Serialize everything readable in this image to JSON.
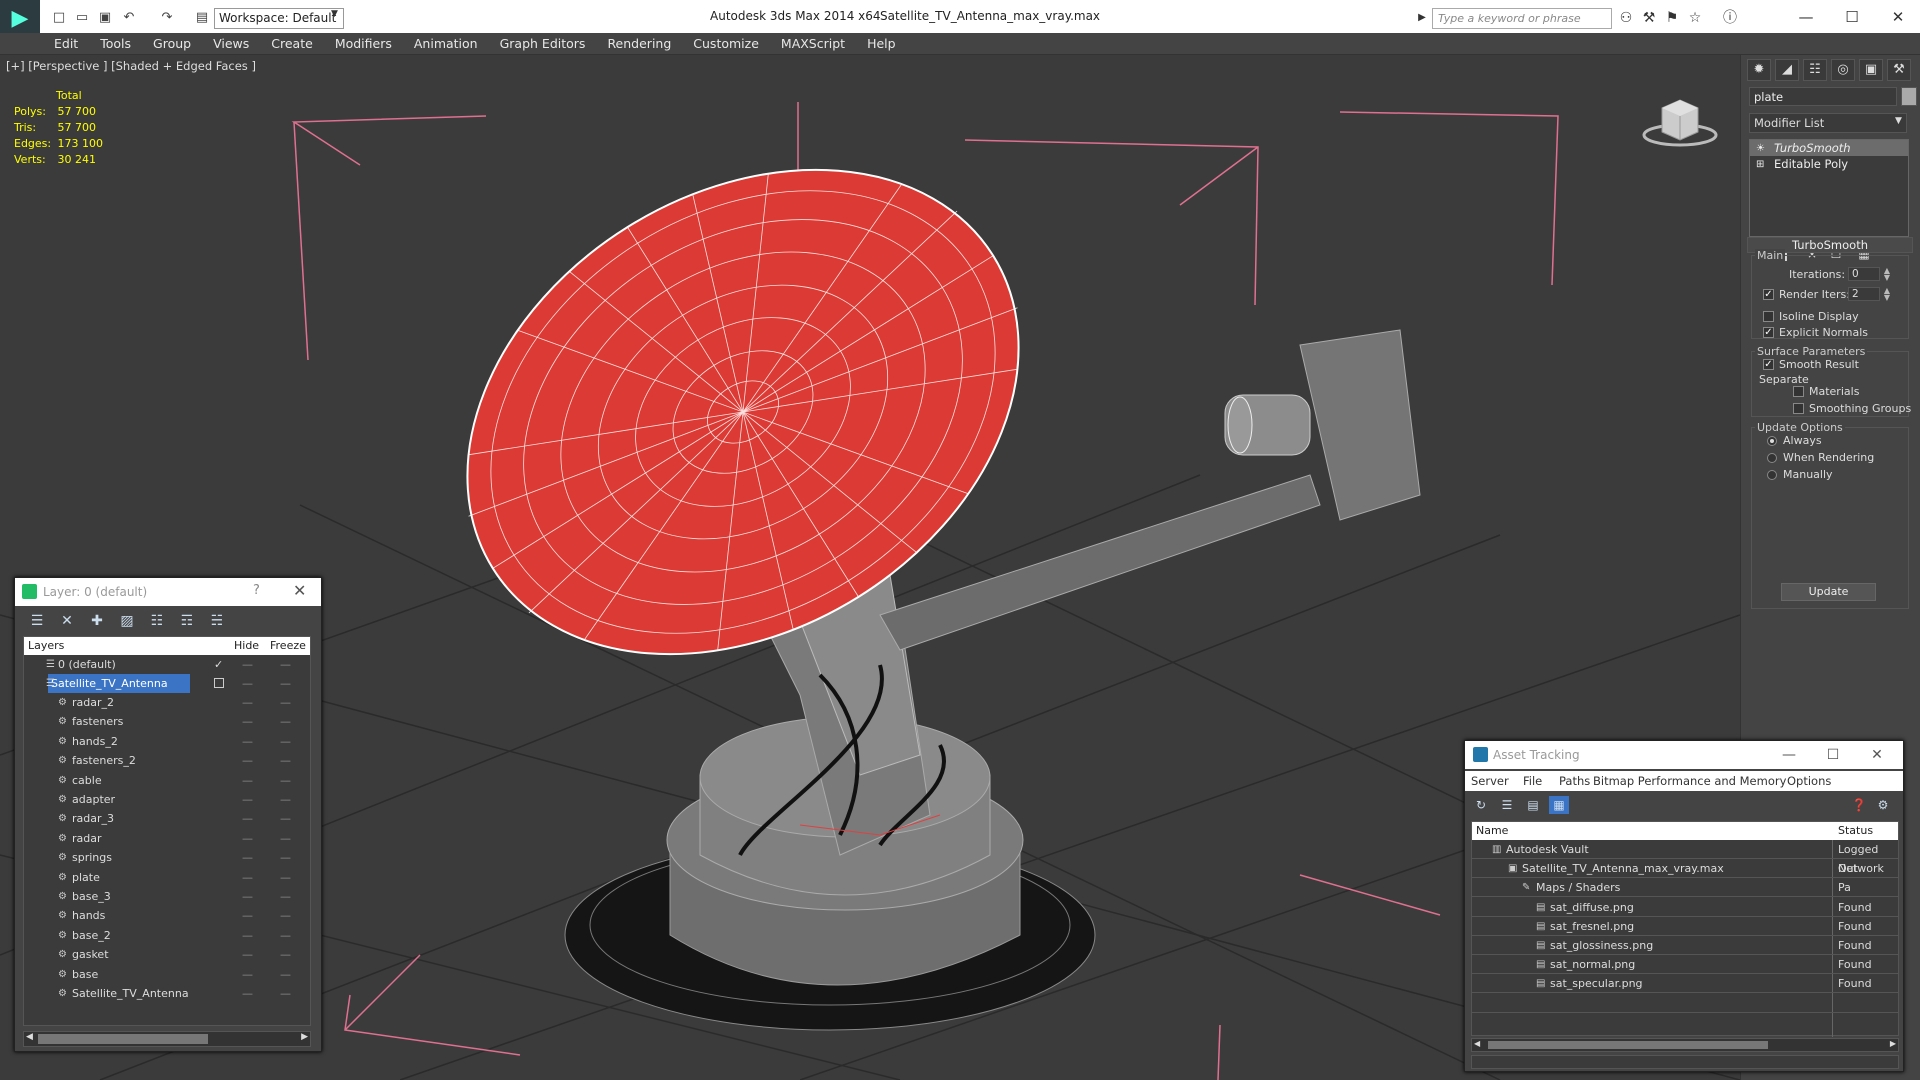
{
  "titlebar": {
    "app_title": "Autodesk 3ds Max  2014 x64",
    "file_name": "Satellite_TV_Antenna_max_vray.max",
    "workspace": "Workspace: Default",
    "search_placeholder": "Type a keyword or phrase",
    "minimize": "—",
    "maximize": "☐",
    "close": "✕"
  },
  "menu": [
    "Edit",
    "Tools",
    "Group",
    "Views",
    "Create",
    "Modifiers",
    "Animation",
    "Graph Editors",
    "Rendering",
    "Customize",
    "MAXScript",
    "Help"
  ],
  "viewport": {
    "label": "[+] [Perspective ] [Shaded + Edged Faces ]",
    "stats": {
      "header": "Total",
      "rows": [
        {
          "label": "Polys:",
          "value": "57 700"
        },
        {
          "label": "Tris:",
          "value": "57 700"
        },
        {
          "label": "Edges:",
          "value": "173 100"
        },
        {
          "label": "Verts:",
          "value": "30 241"
        }
      ]
    },
    "colors": {
      "dish": "#dc3a34",
      "wire": "#ffffff",
      "bbox": "#e06a8c",
      "grid": "#2c2c2c",
      "model": "#7a7a7a"
    }
  },
  "command_panel": {
    "object_name": "plate",
    "modifier_list": "Modifier List",
    "stack": [
      "TurboSmooth",
      "Editable Poly"
    ],
    "rollout_title": "TurboSmooth",
    "main_group": "Main",
    "iterations_label": "Iterations:",
    "iterations_value": "0",
    "render_iters_label": "Render Iters:",
    "render_iters_value": "2",
    "isoline_display": "Isoline Display",
    "explicit_normals": "Explicit Normals",
    "surface_params": "Surface Parameters",
    "smooth_result": "Smooth Result",
    "separate": "Separate",
    "materials": "Materials",
    "smoothing_groups": "Smoothing Groups",
    "update_options": "Update Options",
    "always": "Always",
    "when_rendering": "When Rendering",
    "manually": "Manually",
    "update_button": "Update"
  },
  "layer_window": {
    "title": "Layer: 0 (default)",
    "help": "?",
    "close": "✕",
    "col_layers": "Layers",
    "col_hide": "Hide",
    "col_freeze": "Freeze",
    "default_layer": "0 (default)",
    "selected_layer": "Satellite_TV_Antenna",
    "children": [
      "radar_2",
      "fasteners",
      "hands_2",
      "fasteners_2",
      "cable",
      "adapter",
      "radar_3",
      "radar",
      "springs",
      "plate",
      "base_3",
      "hands",
      "base_2",
      "gasket",
      "base",
      "Satellite_TV_Antenna"
    ]
  },
  "asset_window": {
    "title": "Asset Tracking",
    "menu": [
      "Server",
      "File",
      "Paths",
      "Bitmap Performance and Memory",
      "Options"
    ],
    "col_name": "Name",
    "col_status": "Status",
    "rows": [
      {
        "name": "Autodesk Vault",
        "status": "Logged Out"
      },
      {
        "name": "Satellite_TV_Antenna_max_vray.max",
        "status": "Network Pa"
      },
      {
        "name": "Maps / Shaders",
        "status": ""
      },
      {
        "name": "sat_diffuse.png",
        "status": "Found"
      },
      {
        "name": "sat_fresnel.png",
        "status": "Found"
      },
      {
        "name": "sat_glossiness.png",
        "status": "Found"
      },
      {
        "name": "sat_normal.png",
        "status": "Found"
      },
      {
        "name": "sat_specular.png",
        "status": "Found"
      }
    ]
  }
}
